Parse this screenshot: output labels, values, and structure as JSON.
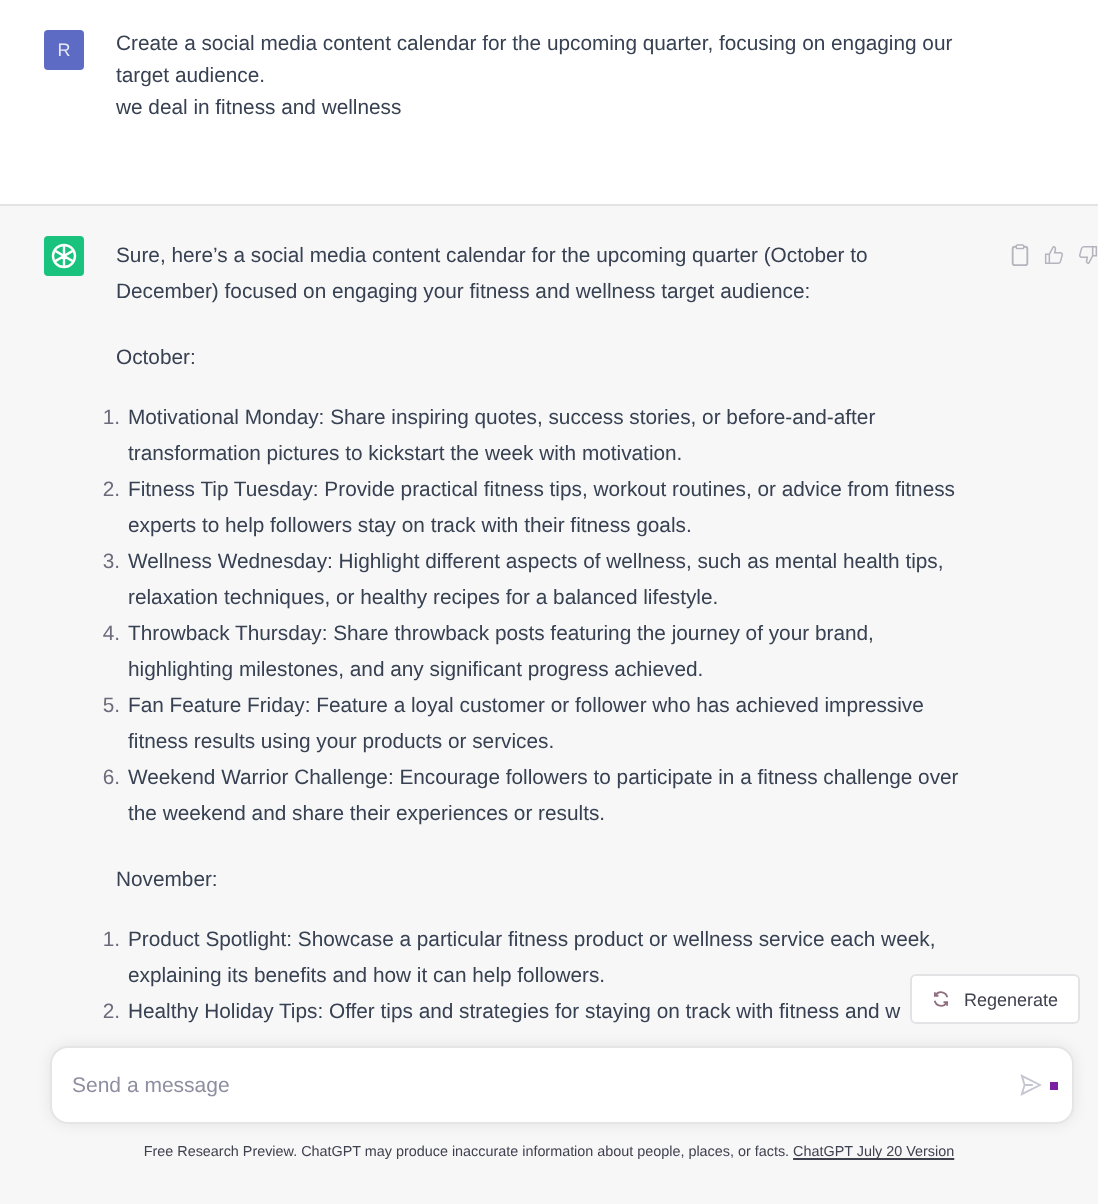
{
  "user_message": {
    "avatar": "R",
    "paragraphs": [
      "Create a social media content calendar for the upcoming quarter, focusing on engaging our target audience.",
      "we deal in fitness and wellness"
    ]
  },
  "assistant_message": {
    "intro": "Sure, here’s a social media content calendar for the upcoming quarter (October to December) focused on engaging your fitness and wellness target audience:",
    "sections": [
      {
        "heading": "October:",
        "items": [
          {
            "number": "1.",
            "text": "Motivational Monday: Share inspiring quotes, success stories, or before-and-after transformation pictures to kickstart the week with motivation."
          },
          {
            "number": "2.",
            "text": "Fitness Tip Tuesday: Provide practical fitness tips, workout routines, or advice from fitness experts to help followers stay on track with their fitness goals."
          },
          {
            "number": "3.",
            "text": "Wellness Wednesday: Highlight different aspects of wellness, such as mental health tips, relaxation techniques, or healthy recipes for a balanced lifestyle."
          },
          {
            "number": "4.",
            "text": "Throwback Thursday: Share throwback posts featuring the journey of your brand, highlighting milestones, and any significant progress achieved."
          },
          {
            "number": "5.",
            "text": "Fan Feature Friday: Feature a loyal customer or follower who has achieved impressive fitness results using your products or services."
          },
          {
            "number": "6.",
            "text": "Weekend Warrior Challenge: Encourage followers to participate in a fitness challenge over the weekend and share their experiences or results."
          }
        ]
      },
      {
        "heading": "November:",
        "items": [
          {
            "number": "1.",
            "text": "Product Spotlight: Showcase a particular fitness product or wellness service each week, explaining its benefits and how it can help followers."
          },
          {
            "number": "2.",
            "text": "Healthy Holiday Tips: Offer tips and strategies for staying on track with fitness and w"
          }
        ]
      }
    ]
  },
  "regenerate_button": {
    "label": "Regenerate"
  },
  "composer": {
    "placeholder": "Send a message"
  },
  "footer": {
    "text": "Free Research Preview. ChatGPT may produce inaccurate information about people, places, or facts.",
    "link": "ChatGPT July 20 Version"
  }
}
